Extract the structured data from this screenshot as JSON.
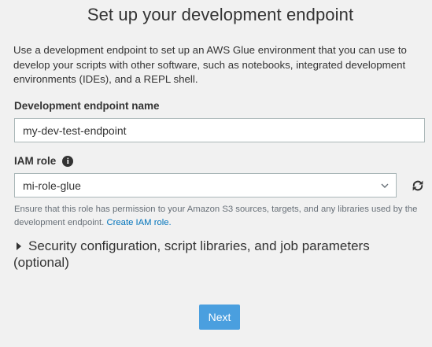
{
  "page": {
    "title": "Set up your development endpoint",
    "intro": "Use a development endpoint to set up an AWS Glue environment that you can use to develop your scripts with other software, such as notebooks, integrated development environments (IDEs), and a REPL shell."
  },
  "endpoint_name": {
    "label": "Development endpoint name",
    "value": "my-dev-test-endpoint"
  },
  "iam_role": {
    "label": "IAM role",
    "selected": "mi-role-glue",
    "hint": "Ensure that this role has permission to your Amazon S3 sources, targets, and any libraries used by the development endpoint.",
    "create_link": "Create IAM role."
  },
  "expander": {
    "label": "Security configuration, script libraries, and job parameters (optional)"
  },
  "actions": {
    "next_label": "Next"
  },
  "colors": {
    "primary_button": "#4a9fdf",
    "link": "#0073bb",
    "background": "#f1f1f1"
  },
  "icons": {
    "info": "info-icon",
    "dropdown": "chevron-down-icon",
    "refresh": "refresh-icon",
    "expander": "caret-right-icon"
  }
}
